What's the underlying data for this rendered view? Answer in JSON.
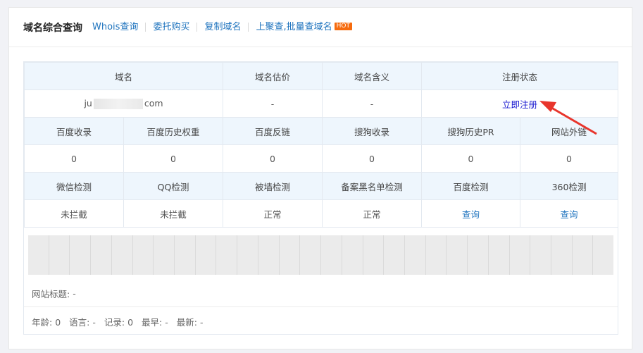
{
  "header": {
    "title": "域名综合查询",
    "links": [
      "Whois查询",
      "委托购买",
      "复制域名",
      "上聚查,批量查域名"
    ],
    "hot_badge": "HOT"
  },
  "row1": {
    "headers": [
      "域名",
      "域名估价",
      "域名含义",
      "注册状态"
    ],
    "domain_prefix": "ju",
    "domain_suffix": "com",
    "valuation": "-",
    "meaning": "-",
    "register": "立即注册"
  },
  "row2": {
    "headers": [
      "百度收录",
      "百度历史权重",
      "百度反链",
      "搜狗收录",
      "搜狗历史PR",
      "网站外链"
    ],
    "values": [
      "0",
      "0",
      "0",
      "0",
      "0",
      "0"
    ]
  },
  "row3": {
    "headers": [
      "微信检测",
      "QQ检测",
      "被墙检测",
      "备案黑名单检测",
      "百度检测",
      "360检测"
    ],
    "values": [
      "未拦截",
      "未拦截",
      "正常",
      "正常",
      "查询",
      "查询"
    ]
  },
  "site_title": {
    "label": "网站标题:",
    "value": "-"
  },
  "stats": [
    {
      "label": "年龄:",
      "value": "0"
    },
    {
      "label": "语言:",
      "value": "-"
    },
    {
      "label": "记录:",
      "value": "0"
    },
    {
      "label": "最早:",
      "value": "-"
    },
    {
      "label": "最新:",
      "value": "-"
    }
  ],
  "colors": {
    "link_blue": "#1e73be",
    "register_blue": "#1a1ad0",
    "status_green": "#2a8a1f",
    "hot_orange": "#f66b0e",
    "arrow_red": "#e8352c"
  }
}
